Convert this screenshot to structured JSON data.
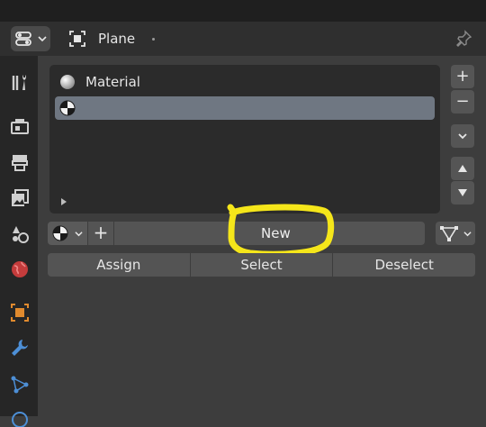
{
  "header": {
    "editor_type_icon": "properties-editor-icon",
    "object_icon": "object-data-icon",
    "object_name": "Plane",
    "pin_icon": "pin-icon"
  },
  "sidebar": {
    "tabs": [
      {
        "name": "tool",
        "icon": "tool-icon"
      },
      {
        "name": "render",
        "icon": "render-icon"
      },
      {
        "name": "output",
        "icon": "output-icon"
      },
      {
        "name": "view-layer",
        "icon": "view-layer-icon"
      },
      {
        "name": "scene",
        "icon": "scene-icon"
      },
      {
        "name": "world",
        "icon": "world-icon"
      },
      {
        "name": "object",
        "icon": "object-icon"
      },
      {
        "name": "modifiers",
        "icon": "wrench-icon"
      },
      {
        "name": "particles",
        "icon": "particles-icon"
      }
    ],
    "active_tab": "material"
  },
  "material_slots": {
    "slots": [
      {
        "label": "Material",
        "icon": "material-sphere-icon",
        "selected": false
      },
      {
        "label": "",
        "icon": "material-ball-icon",
        "selected": true
      }
    ],
    "add_label": "+",
    "remove_label": "−",
    "menu_icon": "chevron-down-icon",
    "move_up_icon": "triangle-up-icon",
    "move_down_icon": "triangle-down-icon"
  },
  "material_bar": {
    "browse_icon": "material-ball-icon",
    "add_label": "+",
    "new_label": "New",
    "mode_icon": "vertex-select-icon"
  },
  "actions": {
    "assign": "Assign",
    "select": "Select",
    "deselect": "Deselect"
  },
  "colors": {
    "selected_row": "#6f7782",
    "annotation_highlight": "#f5e61a"
  }
}
